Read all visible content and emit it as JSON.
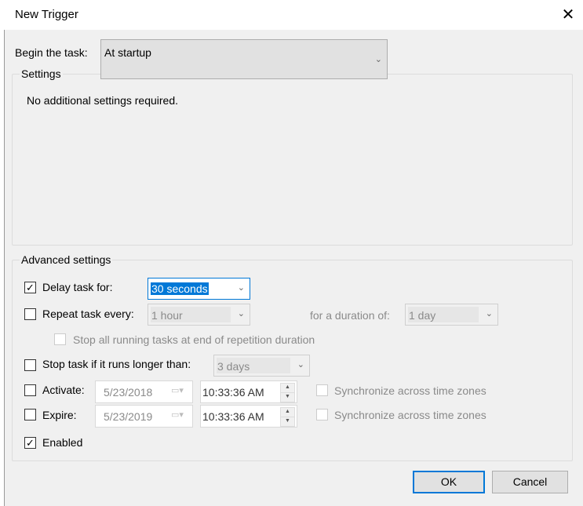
{
  "window": {
    "title": "New Trigger",
    "close_icon": "close-icon"
  },
  "begin": {
    "label": "Begin the task:",
    "value": "At startup"
  },
  "settings": {
    "legend": "Settings",
    "message": "No additional settings required."
  },
  "advanced": {
    "legend": "Advanced settings",
    "delay": {
      "label": "Delay task for:",
      "checked": true,
      "value": "30 seconds"
    },
    "repeat": {
      "label": "Repeat task every:",
      "checked": false,
      "value": "1 hour",
      "duration_label": "for a duration of:",
      "duration_value": "1 day"
    },
    "stop_all": {
      "label": "Stop all running tasks at end of repetition duration",
      "checked": false
    },
    "stop_task": {
      "label": "Stop task if it runs longer than:",
      "checked": false,
      "value": "3 days"
    },
    "activate": {
      "label": "Activate:",
      "checked": false,
      "date": "5/23/2018",
      "time": "10:33:36 AM",
      "sync_label": "Synchronize across time zones"
    },
    "expire": {
      "label": "Expire:",
      "checked": false,
      "date": "5/23/2019",
      "time": "10:33:36 AM",
      "sync_label": "Synchronize across time zones"
    },
    "enabled": {
      "label": "Enabled",
      "checked": true
    }
  },
  "buttons": {
    "ok": "OK",
    "cancel": "Cancel"
  },
  "colors": {
    "accent": "#0078d7",
    "selection": "#0078d7"
  }
}
